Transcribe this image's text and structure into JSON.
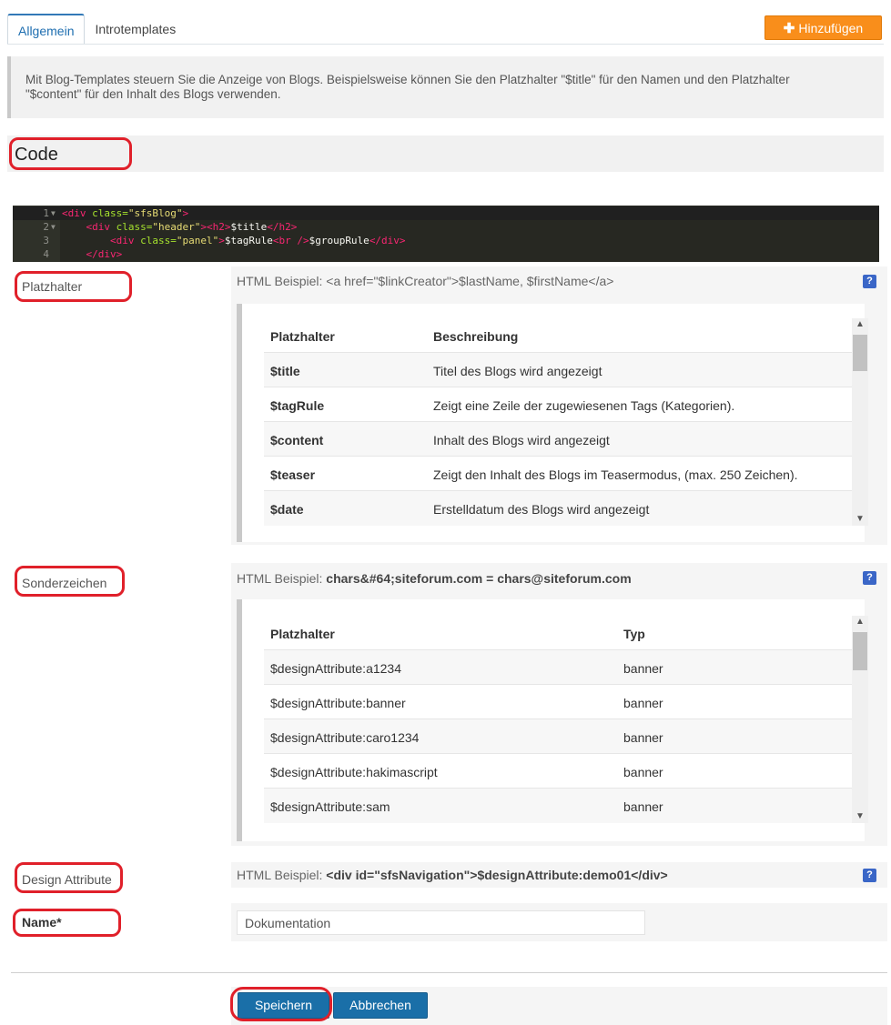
{
  "tabs": [
    {
      "label": "Allgemein",
      "active": true
    },
    {
      "label": "Introtemplates",
      "active": false
    }
  ],
  "add_button": {
    "label": "Hinzufügen",
    "icon": "plus-icon"
  },
  "info_text_line1": "Mit Blog-Templates steuern Sie die Anzeige von Blogs. Beispielsweise können Sie den Platzhalter \"$title\" für den Namen und den Platzhalter",
  "info_text_line2": "\"$content\" für den Inhalt des Blogs verwenden.",
  "code_section": {
    "title": "Code"
  },
  "code_editor": {
    "lines": [
      {
        "num": "1",
        "fold": true,
        "indent": "",
        "tokens": [
          [
            "tag",
            "<div "
          ],
          [
            "attr",
            "class="
          ],
          [
            "str",
            "\"sfsBlog\""
          ],
          [
            "tag",
            ">"
          ]
        ]
      },
      {
        "num": "2",
        "fold": true,
        "indent": "    ",
        "tokens": [
          [
            "tag",
            "<div "
          ],
          [
            "attr",
            "class="
          ],
          [
            "str",
            "\"header\""
          ],
          [
            "tag",
            "><h2>"
          ],
          [
            "plain",
            "$title"
          ],
          [
            "tag",
            "</h2>"
          ]
        ]
      },
      {
        "num": "3",
        "fold": false,
        "indent": "        ",
        "tokens": [
          [
            "tag",
            "<div "
          ],
          [
            "attr",
            "class="
          ],
          [
            "str",
            "\"panel\""
          ],
          [
            "tag",
            ">"
          ],
          [
            "plain",
            "$tagRule"
          ],
          [
            "tag",
            "<br />"
          ],
          [
            "plain",
            "$groupRule"
          ],
          [
            "tag",
            "</div>"
          ]
        ]
      },
      {
        "num": "4",
        "fold": false,
        "indent": "    ",
        "tokens": [
          [
            "tag",
            "</div>"
          ]
        ]
      }
    ]
  },
  "platzhalter": {
    "label": "Platzhalter",
    "hint_prefix": "HTML Beispiel: ",
    "hint_example": "<a href=\"$linkCreator\">$lastName, $firstName</a>",
    "headers": [
      "Platzhalter",
      "Beschreibung"
    ],
    "rows": [
      [
        "$title",
        "Titel des Blogs wird angezeigt"
      ],
      [
        "$tagRule",
        "Zeigt eine Zeile der zugewiesenen Tags (Kategorien)."
      ],
      [
        "$content",
        "Inhalt des Blogs wird angezeigt"
      ],
      [
        "$teaser",
        "Zeigt den Inhalt des Blogs im Teasermodus, (max. 250 Zeichen)."
      ],
      [
        "$date",
        "Erstelldatum des Blogs wird angezeigt"
      ]
    ]
  },
  "sonderzeichen": {
    "label": "Sonderzeichen",
    "hint_prefix": "HTML Beispiel: ",
    "hint_example": "chars&#64;siteforum.com = chars@siteforum.com",
    "headers": [
      "Platzhalter",
      "Typ"
    ],
    "rows": [
      [
        "$designAttribute:a1234",
        "banner"
      ],
      [
        "$designAttribute:banner",
        "banner"
      ],
      [
        "$designAttribute:caro1234",
        "banner"
      ],
      [
        "$designAttribute:hakimascript",
        "banner"
      ],
      [
        "$designAttribute:sam",
        "banner"
      ]
    ]
  },
  "design_attribute": {
    "label": "Design Attribute",
    "hint_prefix": "HTML Beispiel: ",
    "hint_example": "<div id=\"sfsNavigation\">$designAttribute:demo01</div>"
  },
  "name_field": {
    "label": "Name*",
    "value": "Dokumentation"
  },
  "help_icon": "?",
  "buttons": {
    "save": "Speichern",
    "cancel": "Abbrechen"
  },
  "colors": {
    "accent_orange": "#f98e1b",
    "primary_blue": "#1a6fa8",
    "annotation_red": "#e0202a"
  }
}
